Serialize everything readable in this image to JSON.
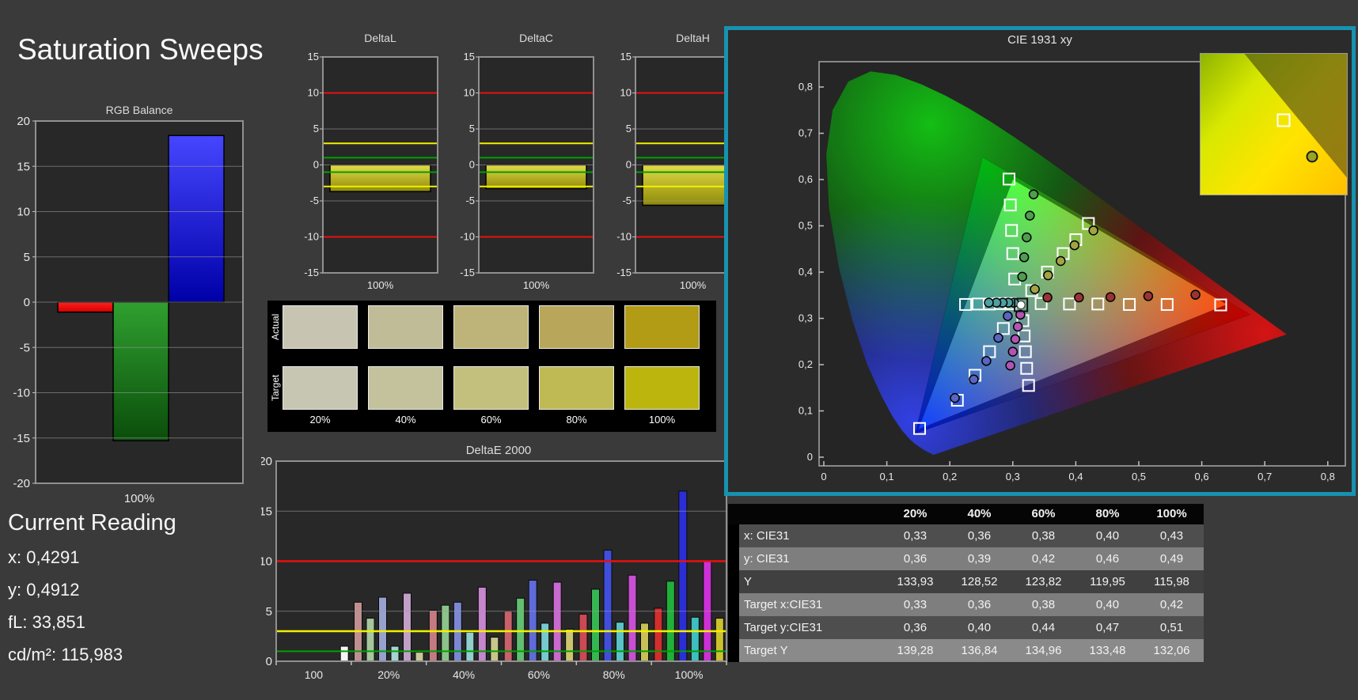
{
  "title": "Saturation Sweeps",
  "accent_teal": "#1792b0",
  "rgb_balance": {
    "title": "RGB Balance",
    "xlabel": "100%",
    "ymin": -20,
    "ymax": 20,
    "ystep": 5,
    "bars": [
      {
        "name": "red",
        "value": -1.1,
        "color_top": "#ff2020",
        "color_bottom": "#d40000"
      },
      {
        "name": "green",
        "value": -15.3,
        "color_top": "#2fa02f",
        "color_bottom": "#0b4d0b"
      },
      {
        "name": "blue",
        "value": 18.4,
        "color_top": "#4646ff",
        "color_bottom": "#0000a8"
      }
    ]
  },
  "current_reading": {
    "heading": "Current Reading",
    "lines": [
      "x: 0,4291",
      "y: 0,4912",
      "fL: 33,851",
      "cd/m²: 115,983"
    ]
  },
  "delta_charts": {
    "ymin": -15,
    "ymax": 15,
    "ystep": 5,
    "xlabel": "100%",
    "limits": {
      "red": 10,
      "yellow": 3,
      "green": 1
    },
    "bar_color_top": "#e2dc48",
    "bar_color_bottom": "#8f8a08",
    "charts": [
      {
        "title": "DeltaL",
        "value": -3.7
      },
      {
        "title": "DeltaC",
        "value": -3.3
      },
      {
        "title": "DeltaH",
        "value": -5.6
      }
    ]
  },
  "swatches": {
    "row_labels": [
      "Actual",
      "Target"
    ],
    "col_labels": [
      "20%",
      "40%",
      "60%",
      "80%",
      "100%"
    ],
    "actual_colors": [
      "#c7c5b2",
      "#c1bc98",
      "#beb47a",
      "#b8a75b",
      "#b29b15"
    ],
    "target_colors": [
      "#c7c6b2",
      "#c4c29c",
      "#c3bf7c",
      "#c0ba55",
      "#bcb50d"
    ]
  },
  "deltae2000": {
    "title": "DeltaE 2000",
    "ymin": 0,
    "ymax": 20,
    "ystep": 5,
    "limits": {
      "red": 10,
      "yellow": 3,
      "green": 1
    },
    "series_names": [
      "red",
      "green",
      "blue",
      "cyan",
      "magenta",
      "yellow"
    ],
    "groups": [
      {
        "label": "100",
        "values": [
          null,
          null,
          null,
          null,
          null,
          1.5
        ],
        "colors": [
          null,
          null,
          null,
          null,
          null,
          "#f5f5f5"
        ]
      },
      {
        "label": "20%",
        "values": [
          5.9,
          4.3,
          6.4,
          1.5,
          6.8,
          0.9
        ],
        "colors": [
          "#c08f92",
          "#a5c79b",
          "#97a1ce",
          "#a8d2d2",
          "#c19fc7",
          "#c7c799"
        ]
      },
      {
        "label": "40%",
        "values": [
          5.1,
          5.6,
          5.9,
          2.9,
          7.4,
          2.4
        ],
        "colors": [
          "#c37b81",
          "#8bc38a",
          "#7c88d3",
          "#91cece",
          "#c586cc",
          "#c8c78a"
        ]
      },
      {
        "label": "60%",
        "values": [
          5.0,
          6.3,
          8.1,
          3.8,
          7.9,
          3.2
        ],
        "colors": [
          "#c7626b",
          "#62be71",
          "#5e6bd8",
          "#76cacd",
          "#c96ad0",
          "#cbc66e"
        ]
      },
      {
        "label": "80%",
        "values": [
          4.7,
          7.2,
          11.1,
          3.9,
          8.6,
          3.8
        ],
        "colors": [
          "#ca4954",
          "#35b652",
          "#404fdb",
          "#59c3c8",
          "#c750d2",
          "#c8c056"
        ]
      },
      {
        "label": "100%",
        "values": [
          5.3,
          8.0,
          17.0,
          4.4,
          10.0,
          4.3
        ],
        "colors": [
          "#d22e2e",
          "#21b03b",
          "#2c2ed5",
          "#3ebebe",
          "#ce30d7",
          "#ccc22d"
        ]
      }
    ]
  },
  "cie": {
    "title": "CIE 1931 xy",
    "xticks": [
      "0",
      "0,1",
      "0,2",
      "0,3",
      "0,4",
      "0,5",
      "0,6",
      "0,7",
      "0,8"
    ],
    "yticks": [
      "0",
      "0,1",
      "0,2",
      "0,3",
      "0,4",
      "0,5",
      "0,6",
      "0,7",
      "0,8"
    ],
    "white_point": [
      0.313,
      0.329
    ],
    "target_gamut": [
      [
        0.64,
        0.33
      ],
      [
        0.3,
        0.6
      ],
      [
        0.15,
        0.06
      ]
    ],
    "native_gamut": [
      [
        0.677,
        0.308
      ],
      [
        0.252,
        0.648
      ],
      [
        0.145,
        0.051
      ]
    ],
    "sweeps": [
      {
        "name": "red",
        "dot_color": "#9a3434",
        "targets": [
          [
            0.345,
            0.332
          ],
          [
            0.39,
            0.331
          ],
          [
            0.435,
            0.331
          ],
          [
            0.485,
            0.33
          ],
          [
            0.545,
            0.33
          ],
          [
            0.63,
            0.329
          ]
        ],
        "measured": [
          [
            0.355,
            0.345
          ],
          [
            0.405,
            0.345
          ],
          [
            0.455,
            0.346
          ],
          [
            0.515,
            0.348
          ],
          [
            0.59,
            0.351
          ]
        ]
      },
      {
        "name": "green",
        "dot_color": "#4f9e4f",
        "targets": [
          [
            0.303,
            0.385
          ],
          [
            0.3,
            0.44
          ],
          [
            0.298,
            0.49
          ],
          [
            0.296,
            0.545
          ],
          [
            0.294,
            0.601
          ]
        ],
        "measured": [
          [
            0.315,
            0.39
          ],
          [
            0.318,
            0.432
          ],
          [
            0.322,
            0.475
          ],
          [
            0.327,
            0.522
          ],
          [
            0.333,
            0.568
          ]
        ]
      },
      {
        "name": "blue",
        "dot_color": "#5a64c2",
        "targets": [
          [
            0.285,
            0.278
          ],
          [
            0.263,
            0.228
          ],
          [
            0.24,
            0.177
          ],
          [
            0.212,
            0.123
          ],
          [
            0.152,
            0.062
          ]
        ],
        "measured": [
          [
            0.292,
            0.305
          ],
          [
            0.277,
            0.258
          ],
          [
            0.258,
            0.208
          ],
          [
            0.238,
            0.168
          ],
          [
            0.208,
            0.128
          ]
        ]
      },
      {
        "name": "cyan",
        "dot_color": "#4fa0a0",
        "targets": [
          [
            0.296,
            0.332
          ],
          [
            0.28,
            0.332
          ],
          [
            0.263,
            0.331
          ],
          [
            0.245,
            0.331
          ],
          [
            0.225,
            0.33
          ]
        ],
        "measured": [
          [
            0.302,
            0.334
          ],
          [
            0.293,
            0.334
          ],
          [
            0.284,
            0.334
          ],
          [
            0.274,
            0.334
          ],
          [
            0.262,
            0.334
          ]
        ]
      },
      {
        "name": "magenta",
        "dot_color": "#b055b2",
        "targets": [
          [
            0.316,
            0.295
          ],
          [
            0.318,
            0.262
          ],
          [
            0.32,
            0.228
          ],
          [
            0.322,
            0.192
          ],
          [
            0.325,
            0.155
          ]
        ],
        "measured": [
          [
            0.312,
            0.308
          ],
          [
            0.308,
            0.282
          ],
          [
            0.304,
            0.255
          ],
          [
            0.3,
            0.228
          ],
          [
            0.296,
            0.198
          ]
        ]
      },
      {
        "name": "yellow",
        "dot_color": "#a3a343",
        "targets": [
          [
            0.33,
            0.36
          ],
          [
            0.355,
            0.4
          ],
          [
            0.38,
            0.44
          ],
          [
            0.4,
            0.47
          ],
          [
            0.42,
            0.505
          ]
        ],
        "measured": [
          [
            0.335,
            0.363
          ],
          [
            0.356,
            0.393
          ],
          [
            0.376,
            0.424
          ],
          [
            0.398,
            0.458
          ],
          [
            0.428,
            0.49
          ]
        ]
      }
    ],
    "inset": {
      "square_marker": {
        "x_pct": 57,
        "y_pct": 47
      },
      "dot_marker": {
        "x_pct": 76,
        "y_pct": 73,
        "color": "#9aa324"
      }
    }
  },
  "table": {
    "columns": [
      "",
      "20%",
      "40%",
      "60%",
      "80%",
      "100%"
    ],
    "rows": [
      {
        "label": "x: CIE31",
        "values": [
          "0,33",
          "0,36",
          "0,38",
          "0,40",
          "0,43"
        ],
        "bg": "#4e4e4e"
      },
      {
        "label": "y: CIE31",
        "values": [
          "0,36",
          "0,39",
          "0,42",
          "0,46",
          "0,49"
        ],
        "bg": "#7e7e7e"
      },
      {
        "label": "Y",
        "values": [
          "133,93",
          "128,52",
          "123,82",
          "119,95",
          "115,98"
        ],
        "bg": "#404040"
      },
      {
        "label": "Target x:CIE31",
        "values": [
          "0,33",
          "0,36",
          "0,38",
          "0,40",
          "0,42"
        ],
        "bg": "#7e7e7e"
      },
      {
        "label": "Target y:CIE31",
        "values": [
          "0,36",
          "0,40",
          "0,44",
          "0,47",
          "0,51"
        ],
        "bg": "#4e4e4e"
      },
      {
        "label": "Target Y",
        "values": [
          "139,28",
          "136,84",
          "134,96",
          "133,48",
          "132,06"
        ],
        "bg": "#8a8a8a"
      }
    ]
  }
}
